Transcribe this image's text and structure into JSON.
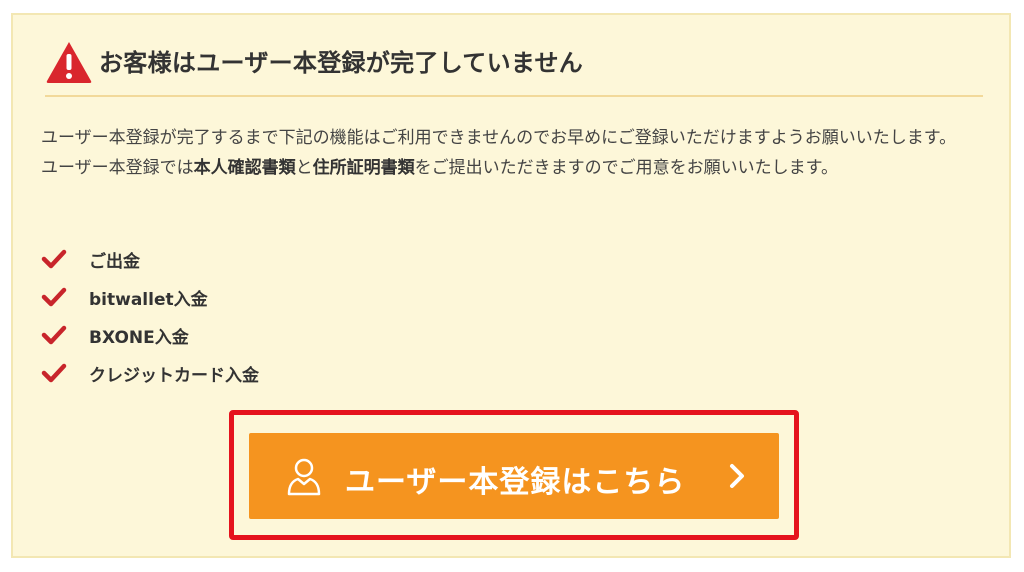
{
  "notice": {
    "title": "お客様はユーザー本登録が完了していません",
    "icon": "warning-icon",
    "line1": "ユーザー本登録が完了するまで下記の機能はご利用できませんのでお早めにご登録いただけますようお願いいたします。",
    "line2_prefix": "ユーザー本登録では",
    "line2_bold1": "本人確認書類",
    "line2_mid": "と",
    "line2_bold2": "住所証明書類",
    "line2_suffix": "をご提出いただきますのでご用意をお願いいたします。"
  },
  "features": {
    "check_icon": "check-icon",
    "items": [
      "ご出金",
      "bitwallet入金",
      "BXONE入金",
      "クレジットカード入金"
    ]
  },
  "cta": {
    "label": "ユーザー本登録はこちら",
    "icon": "user-icon",
    "arrow_icon": "chevron-right-icon"
  },
  "colors": {
    "panel_bg": "#fdf7d9",
    "warning_red": "#d9262d",
    "check_red": "#c8252b",
    "button_orange": "#f5941f",
    "highlight_red": "#e5131d"
  }
}
